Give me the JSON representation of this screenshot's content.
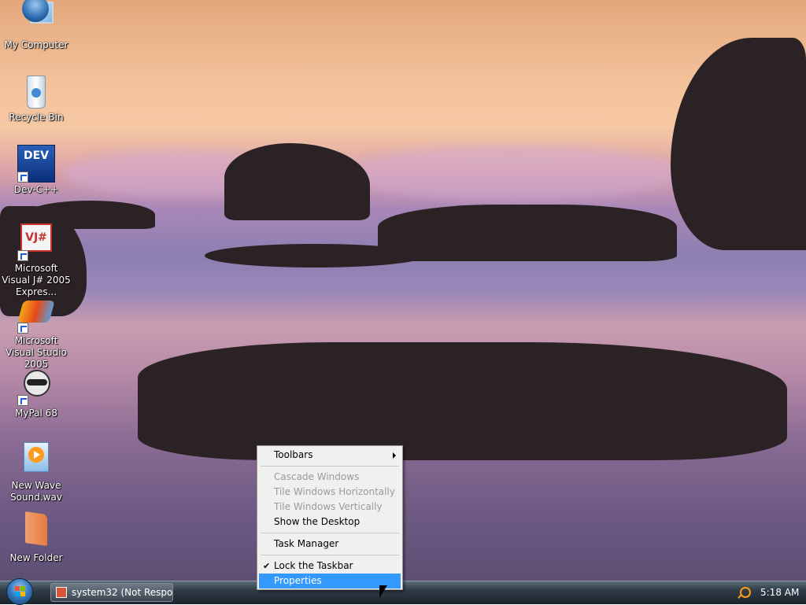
{
  "desktop": {
    "icons": [
      {
        "label": "My Computer",
        "icon": "computer-icon"
      },
      {
        "label": "Recycle Bin",
        "icon": "recycle-bin-icon"
      },
      {
        "label": "Dev-C++",
        "icon": "dev-cpp-icon",
        "badge": "DEV"
      },
      {
        "label": "Microsoft Visual J# 2005 Expres...",
        "icon": "visual-jsharp-icon",
        "badge": "VJ#"
      },
      {
        "label": "Microsoft Visual Studio 2005",
        "icon": "visual-studio-icon"
      },
      {
        "label": "MyPal 68",
        "icon": "raccoon-icon"
      },
      {
        "label": "New Wave Sound.wav",
        "icon": "media-file-icon"
      },
      {
        "label": "New Folder",
        "icon": "folder-icon"
      }
    ]
  },
  "context_menu": {
    "items": [
      {
        "label": "Toolbars",
        "enabled": true,
        "submenu": true
      },
      {
        "label": "Cascade Windows",
        "enabled": false
      },
      {
        "label": "Tile Windows Horizontally",
        "enabled": false
      },
      {
        "label": "Tile Windows Vertically",
        "enabled": false
      },
      {
        "label": "Show the Desktop",
        "enabled": true
      },
      {
        "label": "Task Manager",
        "enabled": true
      },
      {
        "label": "Lock the Taskbar",
        "enabled": true,
        "checked": true
      },
      {
        "label": "Properties",
        "enabled": true,
        "highlighted": true
      }
    ]
  },
  "taskbar": {
    "task_button": "system32 (Not Respo...",
    "clock": "5:18 AM"
  },
  "colors": {
    "menu_highlight": "#3399ff",
    "menu_background": "#f0f0f0",
    "disabled_text": "#9a9a9a"
  }
}
